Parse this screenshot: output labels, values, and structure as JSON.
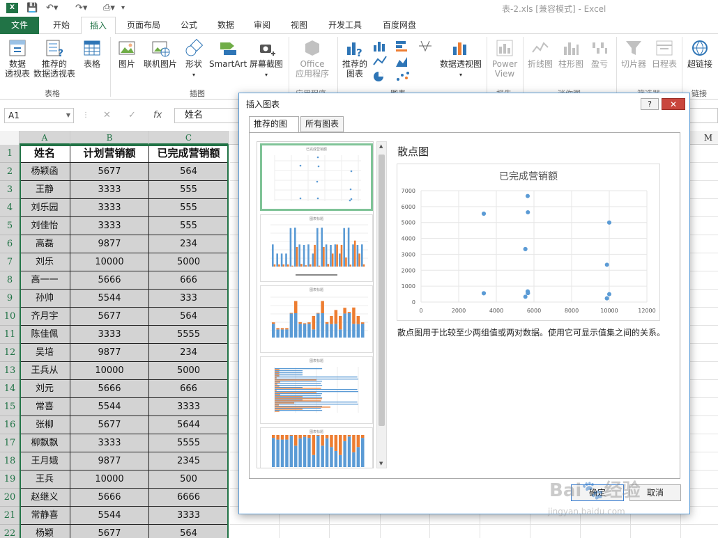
{
  "titlebar": {
    "logo": "X",
    "title": "表-2.xls  [兼容模式] - Excel"
  },
  "tabs": [
    {
      "label": "文件"
    },
    {
      "label": "开始"
    },
    {
      "label": "插入"
    },
    {
      "label": "页面布局"
    },
    {
      "label": "公式"
    },
    {
      "label": "数据"
    },
    {
      "label": "审阅"
    },
    {
      "label": "视图"
    },
    {
      "label": "开发工具"
    },
    {
      "label": "百度网盘"
    }
  ],
  "ribbon": {
    "pivot_l1": "数据",
    "pivot_l2": "透视表",
    "recpivot_l1": "推荐的",
    "recpivot_l2": "数据透视表",
    "table": "表格",
    "grp_table": "表格",
    "picture": "图片",
    "online_picture": "联机图片",
    "shapes": "形状",
    "smartart": "SmartArt",
    "screenshot": "屏幕截图",
    "grp_illus": "插图",
    "office_l1": "Office",
    "office_l2": "应用程序",
    "grp_apps": "应用程序",
    "recchart_l1": "推荐的",
    "recchart_l2": "图表",
    "grp_charts": "图表",
    "pivotchart": "数据透视图",
    "powerview_l1": "Power",
    "powerview_l2": "View",
    "grp_reports": "报告",
    "spark_line": "折线图",
    "spark_col": "柱形图",
    "spark_wl": "盈亏",
    "grp_spark": "迷你图",
    "slicer": "切片器",
    "timeline": "日程表",
    "grp_filter": "筛选器",
    "hyperlink": "超链接",
    "grp_links": "链接"
  },
  "formula_bar": {
    "name_box": "A1",
    "fx": "fx",
    "value": "姓名"
  },
  "columns": [
    "A",
    "B",
    "C"
  ],
  "extra_col": "M",
  "table": {
    "headers": [
      "姓名",
      "计划营销额",
      "已完成营销额"
    ],
    "rows": [
      [
        "杨颖函",
        "5677",
        "564"
      ],
      [
        "王静",
        "3333",
        "555"
      ],
      [
        "刘乐园",
        "3333",
        "555"
      ],
      [
        "刘佳怡",
        "3333",
        "555"
      ],
      [
        "高磊",
        "9877",
        "234"
      ],
      [
        "刘乐",
        "10000",
        "5000"
      ],
      [
        "高一一",
        "5666",
        "666"
      ],
      [
        "孙帅",
        "5544",
        "333"
      ],
      [
        "齐月宇",
        "5677",
        "564"
      ],
      [
        "陈佳佩",
        "3333",
        "5555"
      ],
      [
        "吴培",
        "9877",
        "234"
      ],
      [
        "王兵从",
        "10000",
        "5000"
      ],
      [
        "刘元",
        "5666",
        "666"
      ],
      [
        "常喜",
        "5544",
        "3333"
      ],
      [
        "张柳",
        "5677",
        "5644"
      ],
      [
        "柳飘飘",
        "3333",
        "5555"
      ],
      [
        "王月娥",
        "9877",
        "2345"
      ],
      [
        "王兵",
        "10000",
        "500"
      ],
      [
        "赵继义",
        "5666",
        "6666"
      ],
      [
        "常静喜",
        "5544",
        "3333"
      ],
      [
        "杨颖",
        "5677",
        "564"
      ]
    ]
  },
  "dialog": {
    "title": "插入图表",
    "help": "?",
    "close": "✕",
    "tab_recommended": "推荐的图表",
    "tab_all": "所有图表",
    "preview_title": "散点图",
    "description": "散点图用于比较至少两组值或两对数据。使用它可显示值集之间的关系。",
    "ok": "确定",
    "cancel": "取消",
    "thumb_titles": [
      "已完成营销额",
      "图表标题",
      "图表标题",
      "图表标题",
      "图表标题"
    ]
  },
  "chart_data": {
    "type": "scatter",
    "title": "已完成营销额",
    "xlim": [
      0,
      12000
    ],
    "ylim": [
      0,
      7000
    ],
    "x_ticks": [
      "0",
      "2000",
      "4000",
      "6000",
      "8000",
      "10000",
      "12000"
    ],
    "y_ticks": [
      "0",
      "1000",
      "2000",
      "3000",
      "4000",
      "5000",
      "6000",
      "7000"
    ],
    "grid": true,
    "points": [
      {
        "x": 5677,
        "y": 564
      },
      {
        "x": 3333,
        "y": 555
      },
      {
        "x": 3333,
        "y": 555
      },
      {
        "x": 3333,
        "y": 555
      },
      {
        "x": 9877,
        "y": 234
      },
      {
        "x": 10000,
        "y": 5000
      },
      {
        "x": 5666,
        "y": 666
      },
      {
        "x": 5544,
        "y": 333
      },
      {
        "x": 5677,
        "y": 564
      },
      {
        "x": 3333,
        "y": 5555
      },
      {
        "x": 9877,
        "y": 234
      },
      {
        "x": 10000,
        "y": 5000
      },
      {
        "x": 5666,
        "y": 666
      },
      {
        "x": 5544,
        "y": 3333
      },
      {
        "x": 5677,
        "y": 5644
      },
      {
        "x": 3333,
        "y": 5555
      },
      {
        "x": 9877,
        "y": 2345
      },
      {
        "x": 10000,
        "y": 500
      },
      {
        "x": 5666,
        "y": 6666
      },
      {
        "x": 5544,
        "y": 3333
      },
      {
        "x": 5677,
        "y": 564
      }
    ],
    "color": "#5b9bd5"
  },
  "watermark": {
    "brand": "Bai",
    "brand2": "经验",
    "url": "jingyan.baidu.com"
  }
}
